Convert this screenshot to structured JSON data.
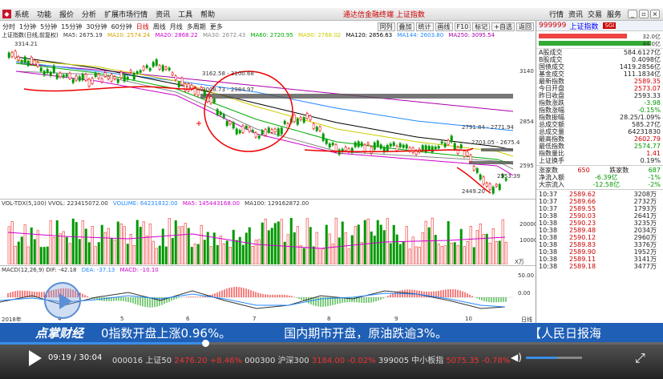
{
  "menubar": {
    "items": [
      "系统",
      "功能",
      "报价",
      "分析",
      "扩展市场行情",
      "资讯",
      "工具",
      "帮助"
    ],
    "center_text": "通达信金融终端",
    "center_text_2": "上证指数",
    "right_items": [
      "行情",
      "资讯",
      "交易",
      "服务"
    ]
  },
  "toolbar": {
    "periods": [
      "分时",
      "1分钟",
      "5分钟",
      "15分钟",
      "30分钟",
      "60分钟",
      "日线",
      "周线",
      "月线",
      "多周期",
      "更多"
    ],
    "active_period": "日线",
    "buttons": [
      "同列",
      "叠加",
      "统计",
      "画线",
      "F10",
      "标记",
      "+自选",
      "返回"
    ]
  },
  "main_chart": {
    "title": "上证指数(日线,前复权)",
    "legend": [
      {
        "label": "MA5: 2675.19",
        "color": "#333333"
      },
      {
        "label": "MA10: 2574.24",
        "color": "#d4a000"
      },
      {
        "label": "MA20: 2868.22",
        "color": "#cc00cc"
      },
      {
        "label": "MA30: 2672.43",
        "color": "#888888"
      },
      {
        "label": "MA60: 2720.95",
        "color": "#00aa00"
      },
      {
        "label": "MA90: 2768.02",
        "color": "#cccc00"
      },
      {
        "label": "MA120: 2856.63",
        "color": "#000000"
      },
      {
        "label": "MA144: 2603.80",
        "color": "#2288ff"
      },
      {
        "label": "MA250: 3095.54",
        "color": "#aa00aa"
      }
    ],
    "y_ticks": [
      "3140",
      "2854",
      "2595"
    ],
    "annotations": [
      "3314.21",
      "3162.58 - 3100.68",
      "3008.73 - 2984.97",
      "2791.84 - 2771.94",
      "2703.05 - 2675.4",
      "2553.39",
      "2449.20"
    ]
  },
  "volume_panel": {
    "legend": [
      {
        "label": "VOL-TDX(5,100)  VVOL: 223415072.00",
        "color": "#333333"
      },
      {
        "label": "VOLUME: 64231832.00",
        "color": "#2288ff"
      },
      {
        "label": "MA5: 145443168.00",
        "color": "#cc00cc"
      },
      {
        "label": "MA100: 129162872.00",
        "color": "#333333"
      }
    ],
    "y_ticks": [
      "20000",
      "10000"
    ],
    "unit": "X万"
  },
  "macd_panel": {
    "legend": [
      {
        "label": "MACD(12,26,9)  DIF: -42.18",
        "color": "#333333"
      },
      {
        "label": "DEA: -37.13",
        "color": "#2288ff"
      },
      {
        "label": "MACD: -10.10",
        "color": "#cc00cc"
      }
    ],
    "y_ticks": [
      "50.00",
      "0.00"
    ],
    "x_labels": [
      "2018年",
      "4",
      "5",
      "6",
      "7",
      "8",
      "9",
      "10"
    ],
    "period_label": "日线"
  },
  "quote_panel": {
    "code": "999999",
    "name": "上证指数",
    "badge": "SGI",
    "bar_values": [
      "32.0亿",
      "44.0亿"
    ],
    "rows": [
      {
        "label": "A股成交",
        "value": "584.6127亿",
        "cls": ""
      },
      {
        "label": "B股成交",
        "value": "0.4098亿",
        "cls": ""
      },
      {
        "label": "国债成交",
        "value": "1419.2856亿",
        "cls": ""
      },
      {
        "label": "基金成交",
        "value": "111.1834亿",
        "cls": ""
      },
      {
        "label": "最新指数",
        "value": "2589.35",
        "cls": "red"
      },
      {
        "label": "今日开盘",
        "value": "2573.07",
        "cls": "red"
      },
      {
        "label": "昨日收盘",
        "value": "2593.33",
        "cls": ""
      },
      {
        "label": "指数涨跌",
        "value": "-3.98",
        "cls": "green"
      },
      {
        "label": "指数涨幅",
        "value": "-0.15%",
        "cls": "green"
      },
      {
        "label": "指数振幅",
        "value": "28.25/1.09%",
        "cls": ""
      },
      {
        "label": "总成交额",
        "value": "585.27亿",
        "cls": ""
      },
      {
        "label": "总成交量",
        "value": "64231830",
        "cls": ""
      },
      {
        "label": "最高指数",
        "value": "2602.79",
        "cls": "red"
      },
      {
        "label": "最低指数",
        "value": "2574.77",
        "cls": "green"
      },
      {
        "label": "指数量比",
        "value": "1.41",
        "cls": "red"
      },
      {
        "label": "上证换手",
        "value": "0.19%",
        "cls": ""
      }
    ],
    "updown": {
      "up_label": "涨家数",
      "up": "650",
      "down_label": "跌家数",
      "down": "687"
    },
    "flows": [
      {
        "label": "净流入额",
        "value": "-6.39亿",
        "pct": "-1%"
      },
      {
        "label": "大宗流入",
        "value": "-12.58亿",
        "pct": "-2%"
      }
    ],
    "ticks": [
      {
        "time": "10:37",
        "price": "2589.62",
        "vol": "3208万"
      },
      {
        "time": "10:37",
        "price": "2589.66",
        "vol": "2732万"
      },
      {
        "time": "10:37",
        "price": "2589.55",
        "vol": "1793万"
      },
      {
        "time": "10:38",
        "price": "2590.03",
        "vol": "2641万"
      },
      {
        "time": "10:38",
        "price": "2590.23",
        "vol": "3235万"
      },
      {
        "time": "10:38",
        "price": "2589.48",
        "vol": "2034万"
      },
      {
        "time": "10:38",
        "price": "2590.12",
        "vol": "2960万"
      },
      {
        "time": "10:38",
        "price": "2589.83",
        "vol": "3376万"
      },
      {
        "time": "10:38",
        "price": "2589.90",
        "vol": "1952万"
      },
      {
        "time": "10:38",
        "price": "2589.11",
        "vol": "3141万"
      },
      {
        "time": "10:38",
        "price": "2589.18",
        "vol": "3477万"
      }
    ]
  },
  "banner": {
    "brand": "点掌财经",
    "news1": "0指数开盘上涨0.96%。",
    "news2": "国内期市开盘，原油跌逾3%。",
    "news3": "【人民日报海"
  },
  "player": {
    "time": "09:19 / 30:04",
    "progress_fraction": 0.31,
    "volume_fraction": 0.55,
    "ticker": "000016 上证50",
    "ticker_val": "2476.20 +8.46%",
    "ticker2": "000300 沪深300",
    "ticker2_val": "3184.00 -0.02%",
    "ticker3": "399005 中小板指",
    "ticker3_val": "5075.35 -0.78%"
  }
}
